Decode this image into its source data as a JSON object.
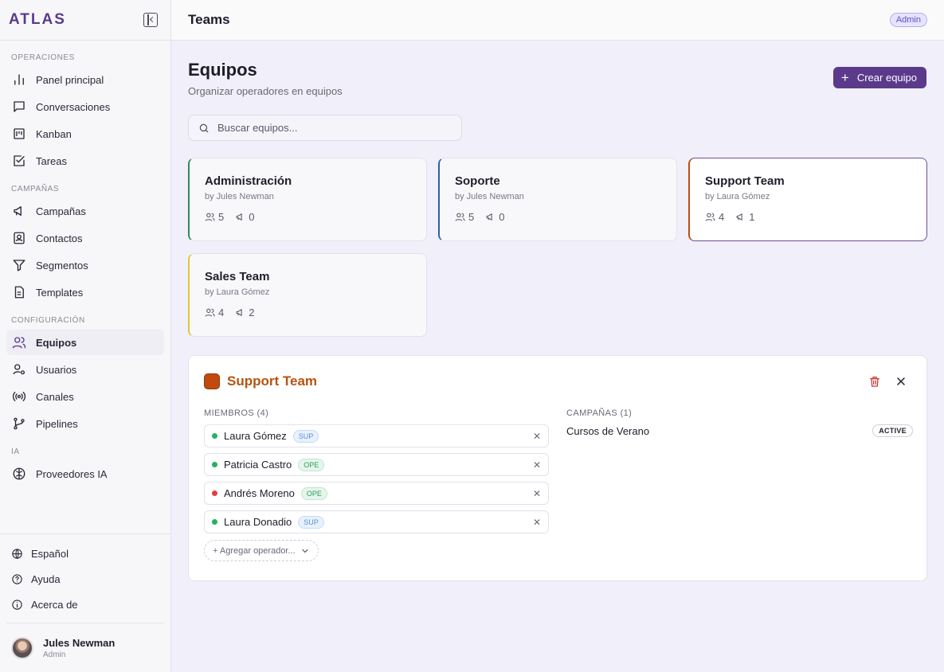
{
  "brand": "ATLAS",
  "sidebar": {
    "sections": [
      {
        "title": "OPERACIONES",
        "items": [
          {
            "label": "Panel principal",
            "icon": "bar-chart-icon"
          },
          {
            "label": "Conversaciones",
            "icon": "message-square-icon"
          },
          {
            "label": "Kanban",
            "icon": "kanban-icon"
          },
          {
            "label": "Tareas",
            "icon": "check-square-icon"
          }
        ]
      },
      {
        "title": "CAMPAÑAS",
        "items": [
          {
            "label": "Campañas",
            "icon": "megaphone-icon"
          },
          {
            "label": "Contactos",
            "icon": "contact-icon"
          },
          {
            "label": "Segmentos",
            "icon": "filter-icon"
          },
          {
            "label": "Templates",
            "icon": "file-text-icon"
          }
        ]
      },
      {
        "title": "CONFIGURACIÓN",
        "items": [
          {
            "label": "Equipos",
            "icon": "users-icon",
            "active": true
          },
          {
            "label": "Usuarios",
            "icon": "user-cog-icon"
          },
          {
            "label": "Canales",
            "icon": "radio-icon"
          },
          {
            "label": "Pipelines",
            "icon": "git-branch-icon"
          }
        ]
      },
      {
        "title": "IA",
        "items": [
          {
            "label": "Proveedores IA",
            "icon": "brain-icon"
          }
        ]
      }
    ],
    "bottom": [
      {
        "label": "Español",
        "icon": "globe-icon"
      },
      {
        "label": "Ayuda",
        "icon": "help-circle-icon"
      },
      {
        "label": "Acerca de",
        "icon": "info-icon"
      }
    ],
    "user": {
      "name": "Jules Newman",
      "role": "Admin"
    }
  },
  "topbar": {
    "title": "Teams",
    "role_badge": "Admin"
  },
  "page": {
    "title": "Equipos",
    "subtitle": "Organizar operadores en equipos",
    "create_label": "Crear equipo",
    "search_placeholder": "Buscar equipos..."
  },
  "teams": [
    {
      "name": "Administración",
      "owner": "by Jules Newman",
      "members": "5",
      "campaigns": "0",
      "accent": "#2e8b57"
    },
    {
      "name": "Soporte",
      "owner": "by Jules Newman",
      "members": "5",
      "campaigns": "0",
      "accent": "#2f5fa8"
    },
    {
      "name": "Support Team",
      "owner": "by Laura Gómez",
      "members": "4",
      "campaigns": "1",
      "accent": "#c24a0f",
      "selected": true
    },
    {
      "name": "Sales Team",
      "owner": "by Laura Gómez",
      "members": "4",
      "campaigns": "2",
      "accent": "#e3c43a"
    }
  ],
  "detail": {
    "title": "Support Team",
    "color": "#c24a0f",
    "members_label": "MIEMBROS (4)",
    "campaigns_label": "CAMPAÑAS (1)",
    "members": [
      {
        "name": "Laura Gómez",
        "role": "SUP",
        "status": "#22b35e"
      },
      {
        "name": "Patricia Castro",
        "role": "OPE",
        "status": "#22b35e"
      },
      {
        "name": "Andrés Moreno",
        "role": "OPE",
        "status": "#e04040"
      },
      {
        "name": "Laura Donadio",
        "role": "SUP",
        "status": "#22b35e"
      }
    ],
    "add_operator": "+ Agregar operador...",
    "campaigns": [
      {
        "name": "Cursos de Verano",
        "status": "ACTIVE"
      }
    ]
  }
}
